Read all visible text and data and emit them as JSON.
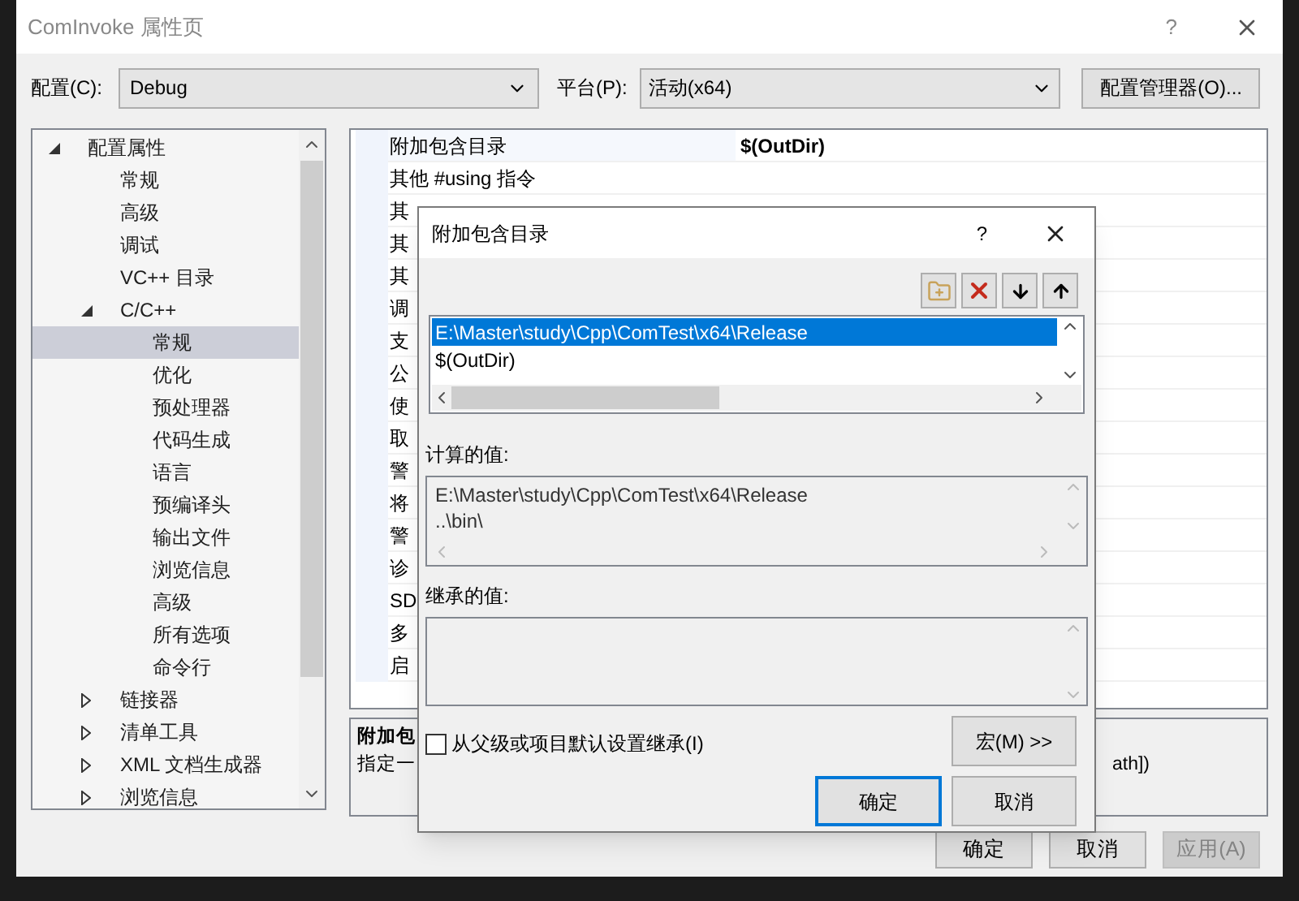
{
  "window": {
    "title": "ComInvoke 属性页",
    "help": "?"
  },
  "config": {
    "label": "配置(C):",
    "value": "Debug"
  },
  "platform": {
    "label": "平台(P):",
    "value": "活动(x64)"
  },
  "config_manager_button": "配置管理器(O)...",
  "tree": [
    {
      "label": "配置属性",
      "selected": false,
      "expanded": true,
      "children": [
        {
          "label": "常规",
          "selected": false
        },
        {
          "label": "高级",
          "selected": false
        },
        {
          "label": "调试",
          "selected": false
        },
        {
          "label": "VC++ 目录",
          "selected": false
        },
        {
          "label": "C/C++",
          "selected": false,
          "expanded": true,
          "children": [
            {
              "label": "常规",
              "selected": true
            },
            {
              "label": "优化",
              "selected": false
            },
            {
              "label": "预处理器",
              "selected": false
            },
            {
              "label": "代码生成",
              "selected": false
            },
            {
              "label": "语言",
              "selected": false
            },
            {
              "label": "预编译头",
              "selected": false
            },
            {
              "label": "输出文件",
              "selected": false
            },
            {
              "label": "浏览信息",
              "selected": false
            },
            {
              "label": "高级",
              "selected": false
            },
            {
              "label": "所有选项",
              "selected": false
            },
            {
              "label": "命令行",
              "selected": false
            }
          ]
        },
        {
          "label": "链接器",
          "selected": false,
          "expanded": false
        },
        {
          "label": "清单工具",
          "selected": false,
          "expanded": false
        },
        {
          "label": "XML 文档生成器",
          "selected": false,
          "expanded": false
        },
        {
          "label": "浏览信息",
          "selected": false,
          "expanded": false
        }
      ]
    }
  ],
  "grid_rows": [
    {
      "name": "附加包含目录",
      "value": "$(OutDir)"
    },
    {
      "name": "其他 #using 指令"
    },
    {
      "name": "其"
    },
    {
      "name": "其"
    },
    {
      "name": "其"
    },
    {
      "name": "调"
    },
    {
      "name": "支"
    },
    {
      "name": "公"
    },
    {
      "name": "使"
    },
    {
      "name": "取"
    },
    {
      "name": "警"
    },
    {
      "name": "将"
    },
    {
      "name": "警"
    },
    {
      "name": "诊"
    },
    {
      "name": "SD"
    },
    {
      "name": "多"
    },
    {
      "name": "启"
    }
  ],
  "description": {
    "title": "附加包",
    "text": "指定一",
    "text_end": "ath])"
  },
  "buttons": [
    {
      "label": "确定",
      "disabled": false
    },
    {
      "label": "取消",
      "disabled": false
    },
    {
      "label": "应用(A)",
      "disabled": true
    }
  ],
  "dialog": {
    "title": "附加包含目录",
    "help": "?",
    "list": [
      {
        "text": "E:\\Master\\study\\Cpp\\ComTest\\x64\\Release",
        "selected": true
      },
      {
        "text": "$(OutDir)",
        "selected": false
      }
    ],
    "computed_label": "计算的值:",
    "computed": [
      "E:\\Master\\study\\Cpp\\ComTest\\x64\\Release",
      "..\\bin\\"
    ],
    "inherited_label": "继承的值:",
    "inherit_checkbox": {
      "label": "从父级或项目默认设置继承(I)",
      "checked": false
    },
    "macro_button": "宏(M) >>",
    "ok": "确定",
    "cancel": "取消"
  }
}
